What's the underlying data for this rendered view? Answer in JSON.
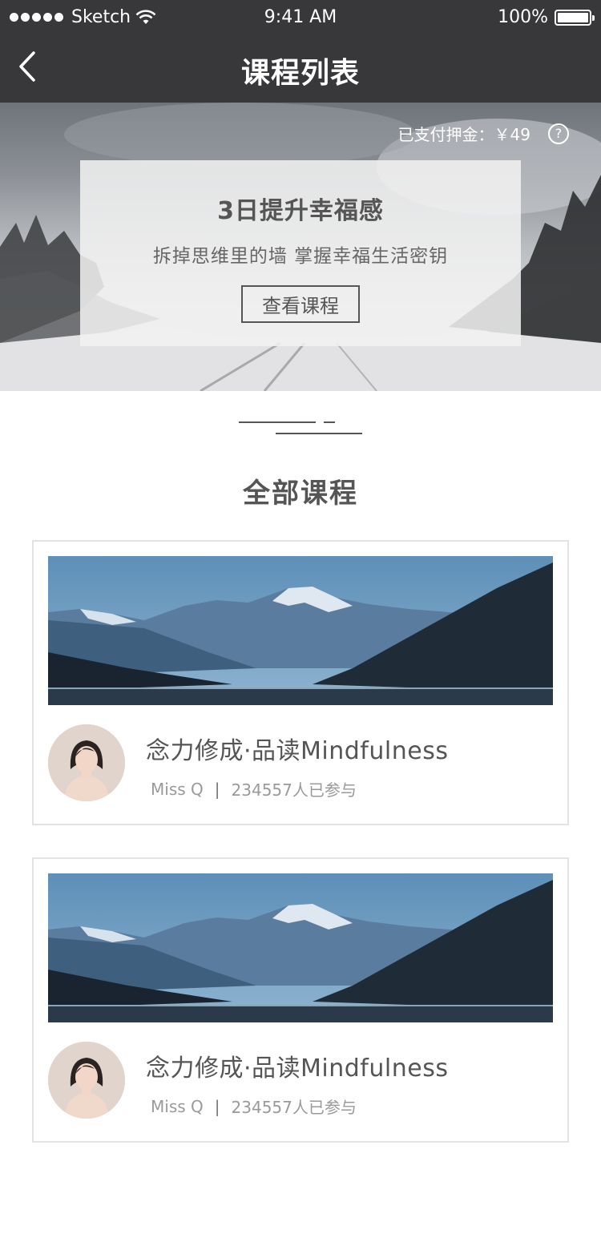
{
  "status_bar": {
    "carrier": "Sketch",
    "time": "9:41 AM",
    "battery": "100%"
  },
  "nav": {
    "title": "课程列表",
    "back_icon": "chevron-left-icon"
  },
  "hero": {
    "deposit_text": "已支付押金：￥49",
    "help_icon": "question-circle-icon",
    "promo": {
      "title": "3日提升幸福感",
      "subtitle": "拆掉思维里的墙 掌握幸福生活密钥",
      "button_label": "查看课程"
    }
  },
  "section": {
    "title": "全部课程"
  },
  "courses": [
    {
      "title": "念力修成·品读Mindfulness",
      "author": "Miss Q",
      "separator": "|",
      "participants": "234557人已参与"
    },
    {
      "title": "念力修成·品读Mindfulness",
      "author": "Miss Q",
      "separator": "|",
      "participants": "234557人已参与"
    }
  ],
  "colors": {
    "nav_bg": "#38383b",
    "text_dark": "#555555",
    "text_muted": "#9a9a9a",
    "card_border": "#e3e3e3"
  }
}
